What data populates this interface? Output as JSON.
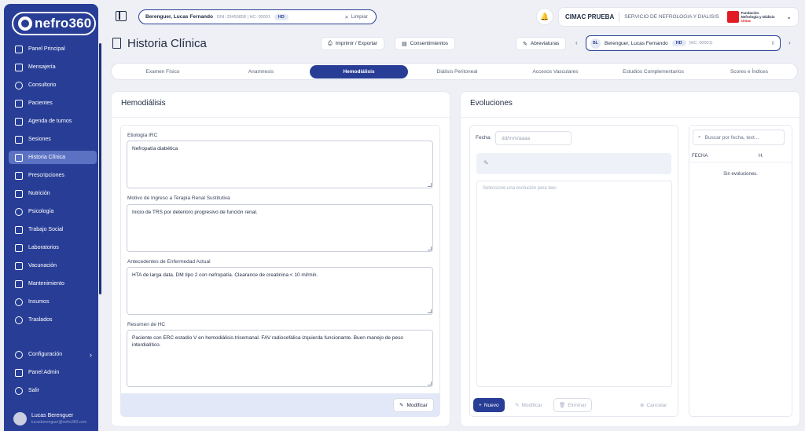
{
  "app": {
    "logo_text": "nefro360"
  },
  "sidebar": {
    "items": [
      {
        "label": "Panel Principal"
      },
      {
        "label": "Mensajería"
      },
      {
        "label": "Consultorio"
      },
      {
        "label": "Pacientes"
      },
      {
        "label": "Agenda de turnos"
      },
      {
        "label": "Sesiones"
      },
      {
        "label": "Historia Clínica"
      },
      {
        "label": "Prescripciones"
      },
      {
        "label": "Nutrición"
      },
      {
        "label": "Psicología"
      },
      {
        "label": "Trabajo Social"
      },
      {
        "label": "Laboratorios"
      },
      {
        "label": "Vacunación"
      },
      {
        "label": "Mantenimiento"
      },
      {
        "label": "Insumos"
      },
      {
        "label": "Traslados"
      }
    ],
    "bottom_items": [
      {
        "label": "Configuración"
      },
      {
        "label": "Panel Admin"
      },
      {
        "label": "Salir"
      }
    ],
    "user": {
      "name": "Lucas Berenguer",
      "email": "lucasberenguer@nefro360.com"
    }
  },
  "topbar": {
    "patient_name": "Berenguer, Lucas Fernando",
    "patient_meta": "DNI: 29455858 | HC: 00001",
    "patient_badge": "HD",
    "clear_label": "Limpiar",
    "center_name": "CIMAC PRUEBA",
    "center_service": "SERVICIO DE NEFROLOGIA Y DIALISIS",
    "center_logo_line1": "Fundación",
    "center_logo_line2": "Nefrología y Diálisis",
    "center_logo_line3": "cimac"
  },
  "header": {
    "title": "Historia Clínica",
    "print_label": "Imprimir / Exportar",
    "consent_label": "Consentimientos",
    "abbrev_label": "Abreviaturas",
    "patient_initials": "BL",
    "patient_name": "Berenguer, Lucas Fernando",
    "patient_badge": "HD",
    "patient_hc": "(HC: 00001)",
    "prev": "‹",
    "next": "›"
  },
  "tabs": [
    {
      "label": "Examen Físico"
    },
    {
      "label": "Anamnesis"
    },
    {
      "label": "Hemodiálisis"
    },
    {
      "label": "Diálisis Peritoneal"
    },
    {
      "label": "Accesos Vasculares"
    },
    {
      "label": "Estudios Complementarios"
    },
    {
      "label": "Scores e Índices"
    }
  ],
  "active_tab": "Hemodiálisis",
  "hemodialisis": {
    "title": "Hemodiálisis",
    "fields": [
      {
        "label": "Etiología IRC",
        "value": "Nefropatía diabética"
      },
      {
        "label": "Motivo de Ingreso a Terapia Renal Sustitutiva",
        "value": "Inicio de TRS por deterioro progresivo de función renal."
      },
      {
        "label": "Antecedentes de Enfermedad Actual",
        "value": "HTA de larga data. DM tipo 2 con nefropatía. Clearance de creatinina < 10 ml/min."
      },
      {
        "label": "Resumen de HC",
        "value": "Paciente con ERC estadío V en hemodiálisis trisemanal. FAV radiocefálica izquierda funcionante. Buen manejo de peso interdialítico."
      }
    ],
    "modify_label": "Modificar"
  },
  "evoluciones": {
    "title": "Evoluciones",
    "date_label": "Fecha:",
    "date_placeholder": "dd/mm/aaaa",
    "text_placeholder": "Seleccione una evolución para leer.",
    "new_label": "Nuevo",
    "modify_label": "Modificar",
    "delete_label": "Eliminar",
    "cancel_label": "Cancelar",
    "search_placeholder": "Buscar por fecha, text...",
    "col_date": "FECHA",
    "col_h": "H.",
    "empty": "Sin evoluciones."
  },
  "colors": {
    "primary": "#283e96",
    "active_nav": "#5b72c3",
    "background": "#eef0f5"
  }
}
